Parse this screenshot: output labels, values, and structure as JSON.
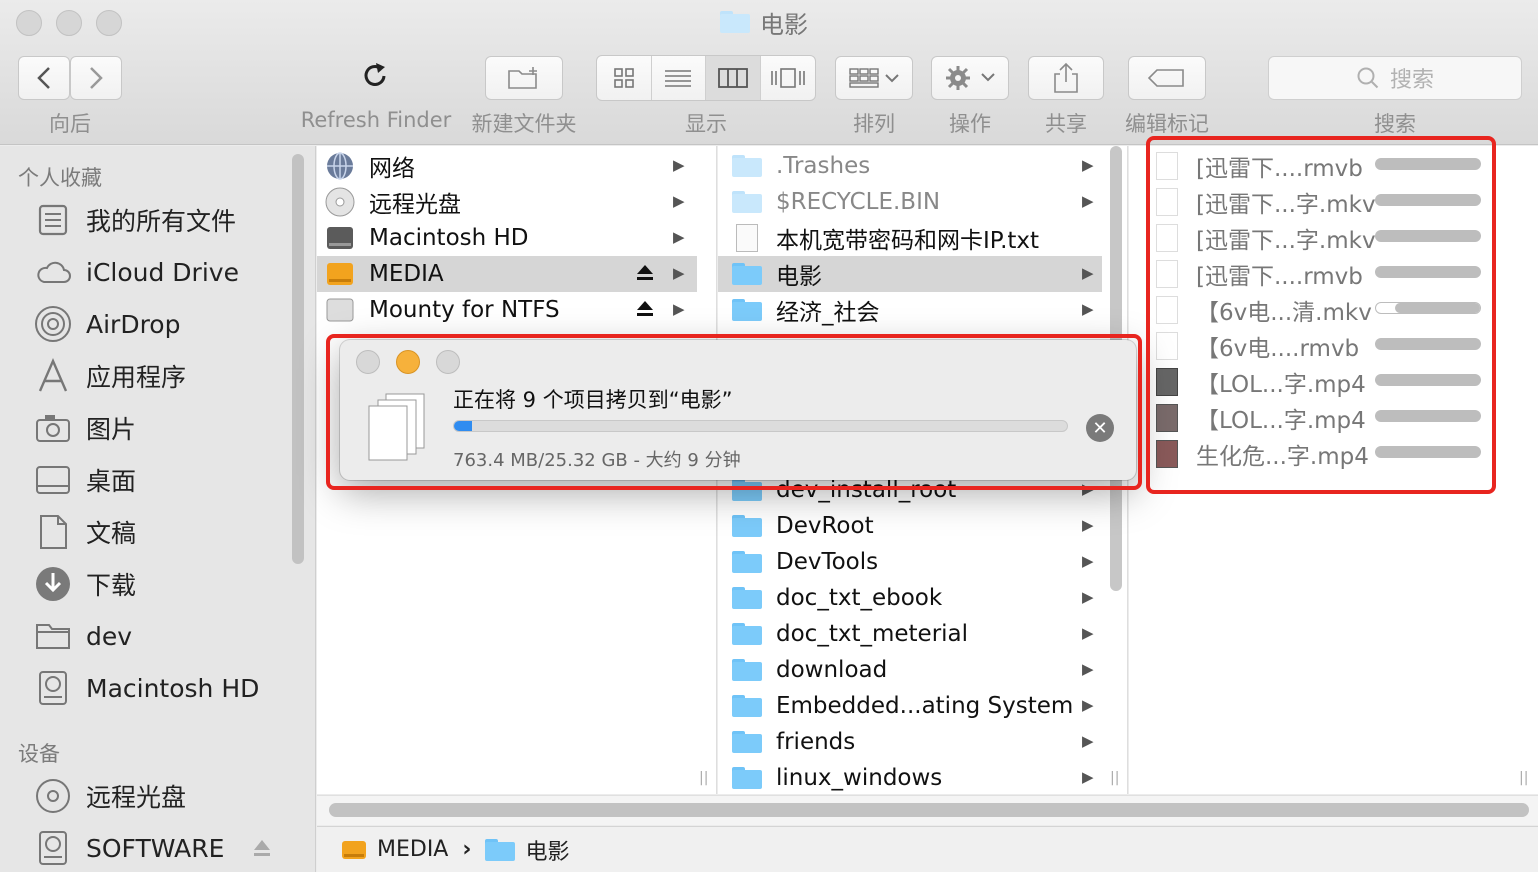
{
  "window": {
    "title": "电影"
  },
  "toolbar": {
    "back_forward_label": "向后",
    "refresh_label": "Refresh Finder",
    "new_folder_label": "新建文件夹",
    "view_label": "显示",
    "arrange_label": "排列",
    "action_label": "操作",
    "share_label": "共享",
    "tags_label": "编辑标记",
    "search_label": "搜索",
    "search_placeholder": "搜索"
  },
  "sidebar": {
    "favorites_header": "个人收藏",
    "favorites": [
      {
        "label": "我的所有文件",
        "icon": "all-files-icon"
      },
      {
        "label": "iCloud Drive",
        "icon": "cloud-icon"
      },
      {
        "label": "AirDrop",
        "icon": "airdrop-icon"
      },
      {
        "label": "应用程序",
        "icon": "applications-icon"
      },
      {
        "label": "图片",
        "icon": "camera-icon"
      },
      {
        "label": "桌面",
        "icon": "desktop-icon"
      },
      {
        "label": "文稿",
        "icon": "documents-icon"
      },
      {
        "label": "下载",
        "icon": "download-icon"
      },
      {
        "label": "dev",
        "icon": "folder-icon"
      },
      {
        "label": "Macintosh HD",
        "icon": "hard-drive-icon"
      }
    ],
    "devices_header": "设备",
    "devices": [
      {
        "label": "远程光盘",
        "icon": "disc-icon"
      },
      {
        "label": "SOFTWARE",
        "icon": "hard-drive-icon"
      }
    ]
  },
  "column1": {
    "items": [
      {
        "label": "网络"
      },
      {
        "label": "远程光盘"
      },
      {
        "label": "Macintosh HD"
      },
      {
        "label": "MEDIA"
      },
      {
        "label": "Mounty for NTFS"
      }
    ]
  },
  "column2": {
    "items_top": [
      {
        "label": ".Trashes"
      },
      {
        "label": "$RECYCLE.BIN"
      },
      {
        "label": "本机宽带密码和网卡IP.txt"
      },
      {
        "label": "电影"
      },
      {
        "label": "经济_社会"
      }
    ],
    "items_bottom": [
      {
        "label": "dev_install_root"
      },
      {
        "label": "DevRoot"
      },
      {
        "label": "DevTools"
      },
      {
        "label": "doc_txt_ebook"
      },
      {
        "label": "doc_txt_meterial"
      },
      {
        "label": "download"
      },
      {
        "label": "Embedded...ating System"
      },
      {
        "label": "friends"
      },
      {
        "label": "linux_windows"
      }
    ]
  },
  "column3": {
    "items": [
      {
        "label": "[迅雷下....rmvb",
        "progress": 0
      },
      {
        "label": "[迅雷下...字.mkv",
        "progress": 0
      },
      {
        "label": "[迅雷下...字.mkv",
        "progress": 0
      },
      {
        "label": "[迅雷下....rmvb",
        "progress": 0
      },
      {
        "label": "【6v电...清.mkv",
        "progress": 0.18
      },
      {
        "label": "【6v电....rmvb",
        "progress": 0
      },
      {
        "label": "【LOL...字.mp4",
        "progress": 0
      },
      {
        "label": "【LOL...字.mp4",
        "progress": 0
      },
      {
        "label": "生化危...字.mp4",
        "progress": 0
      }
    ]
  },
  "pathbar": {
    "volume": "MEDIA",
    "separator": "›",
    "folder": "电影"
  },
  "copy_dialog": {
    "title": "正在将 9 个项目拷贝到“电影”",
    "status": "763.4 MB/25.32 GB - 大约 9 分钟",
    "progress": 0.03
  },
  "colors": {
    "highlight": "#e8251f",
    "progress": "#2f8cf0",
    "folder": "#7ccbfa"
  }
}
